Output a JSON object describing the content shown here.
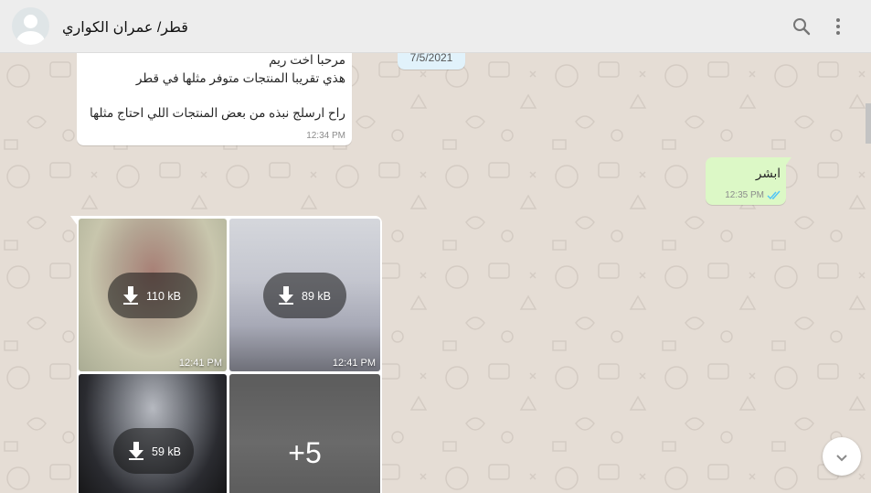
{
  "header": {
    "contact_name": "قطر/ عمران الكواري",
    "avatar": "default-user-avatar",
    "icons": [
      "search-icon",
      "menu-dots-icon"
    ]
  },
  "date_chip": "7/5/2021",
  "messages": {
    "incoming_text": {
      "line1": "مرحبا اخت ريم",
      "line2": "هذي تقريبا المنتجات متوفر مثلها في قطر",
      "line3": "راح ارسلج نبذه من بعض المنتجات اللي احتاج مثلها",
      "time": "12:34 PM"
    },
    "outgoing": {
      "text": "ابشر",
      "time": "12:35 PM",
      "status_icon": "double-check-read-icon"
    },
    "media": {
      "tiles": [
        {
          "size": "110 kB",
          "time": "12:41 PM"
        },
        {
          "size": "89 kB",
          "time": "12:41 PM"
        },
        {
          "size": "59 kB",
          "time": ""
        }
      ],
      "more_count": "+5"
    }
  },
  "colors": {
    "header_bg": "#ededed",
    "chat_bg": "#e5ddd5",
    "outgoing_bg": "#dcf8c6",
    "date_chip_bg": "#e1f2fb",
    "read_tick": "#4fc3f7"
  }
}
